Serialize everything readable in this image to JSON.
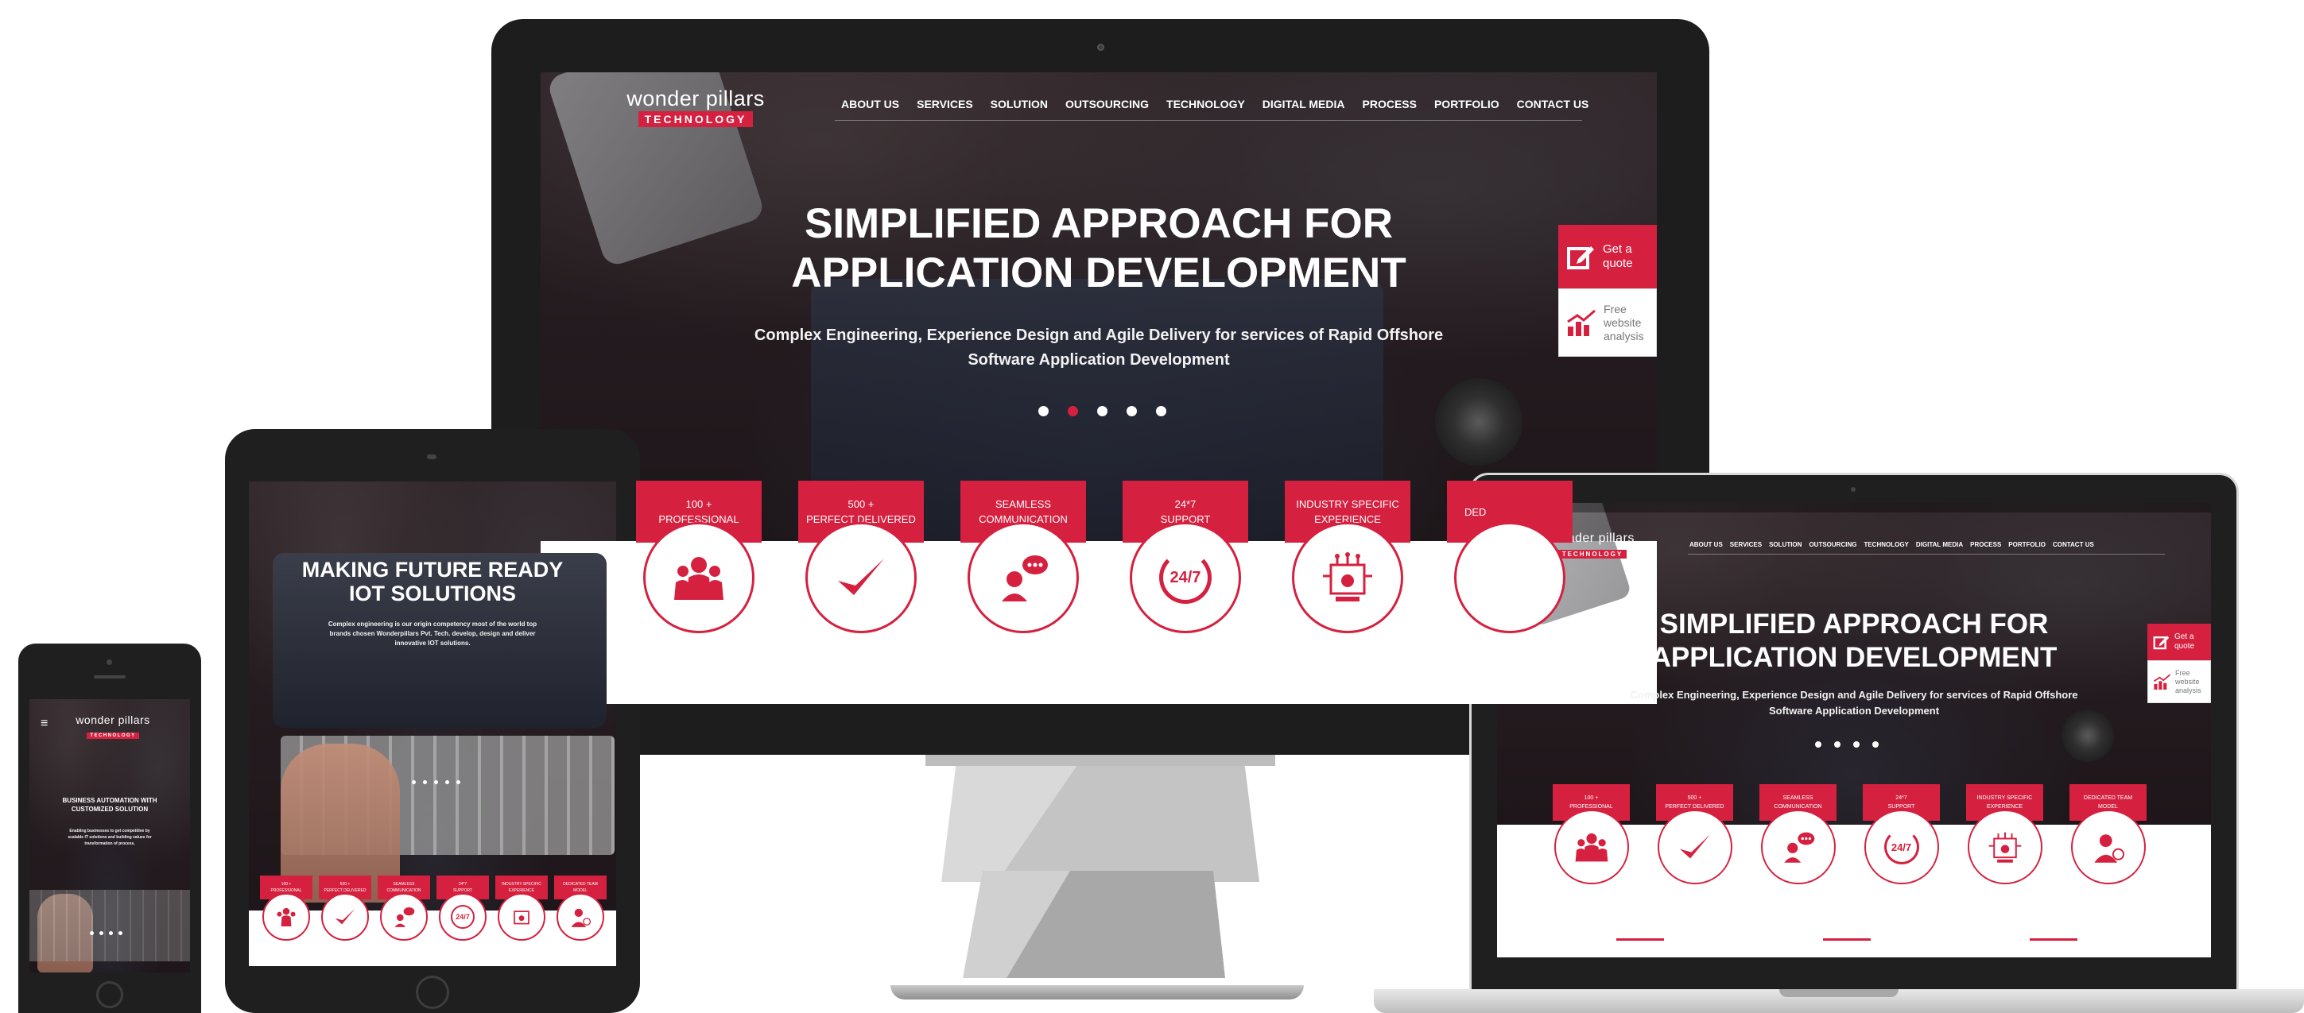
{
  "brand": {
    "name": "wonder pillars",
    "tag": "TECHNOLOGY",
    "accent": "#d5213f"
  },
  "nav": [
    "ABOUT US",
    "SERVICES",
    "SOLUTION",
    "OUTSOURCING",
    "TECHNOLOGY",
    "DIGITAL MEDIA",
    "PROCESS",
    "PORTFOLIO",
    "CONTACT US"
  ],
  "hero": {
    "title_line1": "SIMPLIFIED APPROACH FOR",
    "title_line2": "APPLICATION DEVELOPMENT",
    "sub_line1": "Complex Engineering, Experience Design and Agile Delivery for services of Rapid Offshore",
    "sub_line2": "Software Application Development"
  },
  "quote": {
    "get_quote_1": "Get a",
    "get_quote_2": "quote",
    "free_1": "Free",
    "free_2": "website",
    "free_3": "analysis"
  },
  "cards": [
    {
      "line1": "100 +",
      "line2": "PROFESSIONAL",
      "icon": "team-icon"
    },
    {
      "line1": "500 +",
      "line2": "PERFECT DELIVERED",
      "icon": "check-icon"
    },
    {
      "line1": "SEAMLESS",
      "line2": "COMMUNICATION",
      "icon": "chat-person-icon"
    },
    {
      "line1": "24*7",
      "line2": "SUPPORT",
      "icon": "support-247-icon"
    },
    {
      "line1": "INDUSTRY SPECIFIC",
      "line2": "EXPERIENCE",
      "icon": "circuit-icon"
    },
    {
      "line1": "DEDICATED TEAM",
      "line2": "MODEL",
      "icon": "person-globe-icon"
    }
  ],
  "monitor_partial_card": "DED",
  "support_icon_text": "24/7",
  "tablet": {
    "title_line1": "MAKING FUTURE READY",
    "title_line2": "IOT SOLUTIONS",
    "sub_line1": "Complex engineering is our origin competency most of the world top",
    "sub_line2": "brands chosen Wonderpillars Pvt. Tech. develop, design and deliver",
    "sub_line3": "innovative IOT solutions."
  },
  "phone": {
    "title_line1": "BUSINESS AUTOMATION WITH",
    "title_line2": "CUSTOMIZED SOLUTION",
    "sub_line1": "Enabling businesses to get competitive by",
    "sub_line2": "scalable IT solutions and building values for",
    "sub_line3": "transformation of process.",
    "menu_glyph": "≡"
  },
  "colors": {
    "device_black": "#1f1f1f",
    "stand_grey": "#cfcfcf",
    "accent": "#d5213f"
  }
}
